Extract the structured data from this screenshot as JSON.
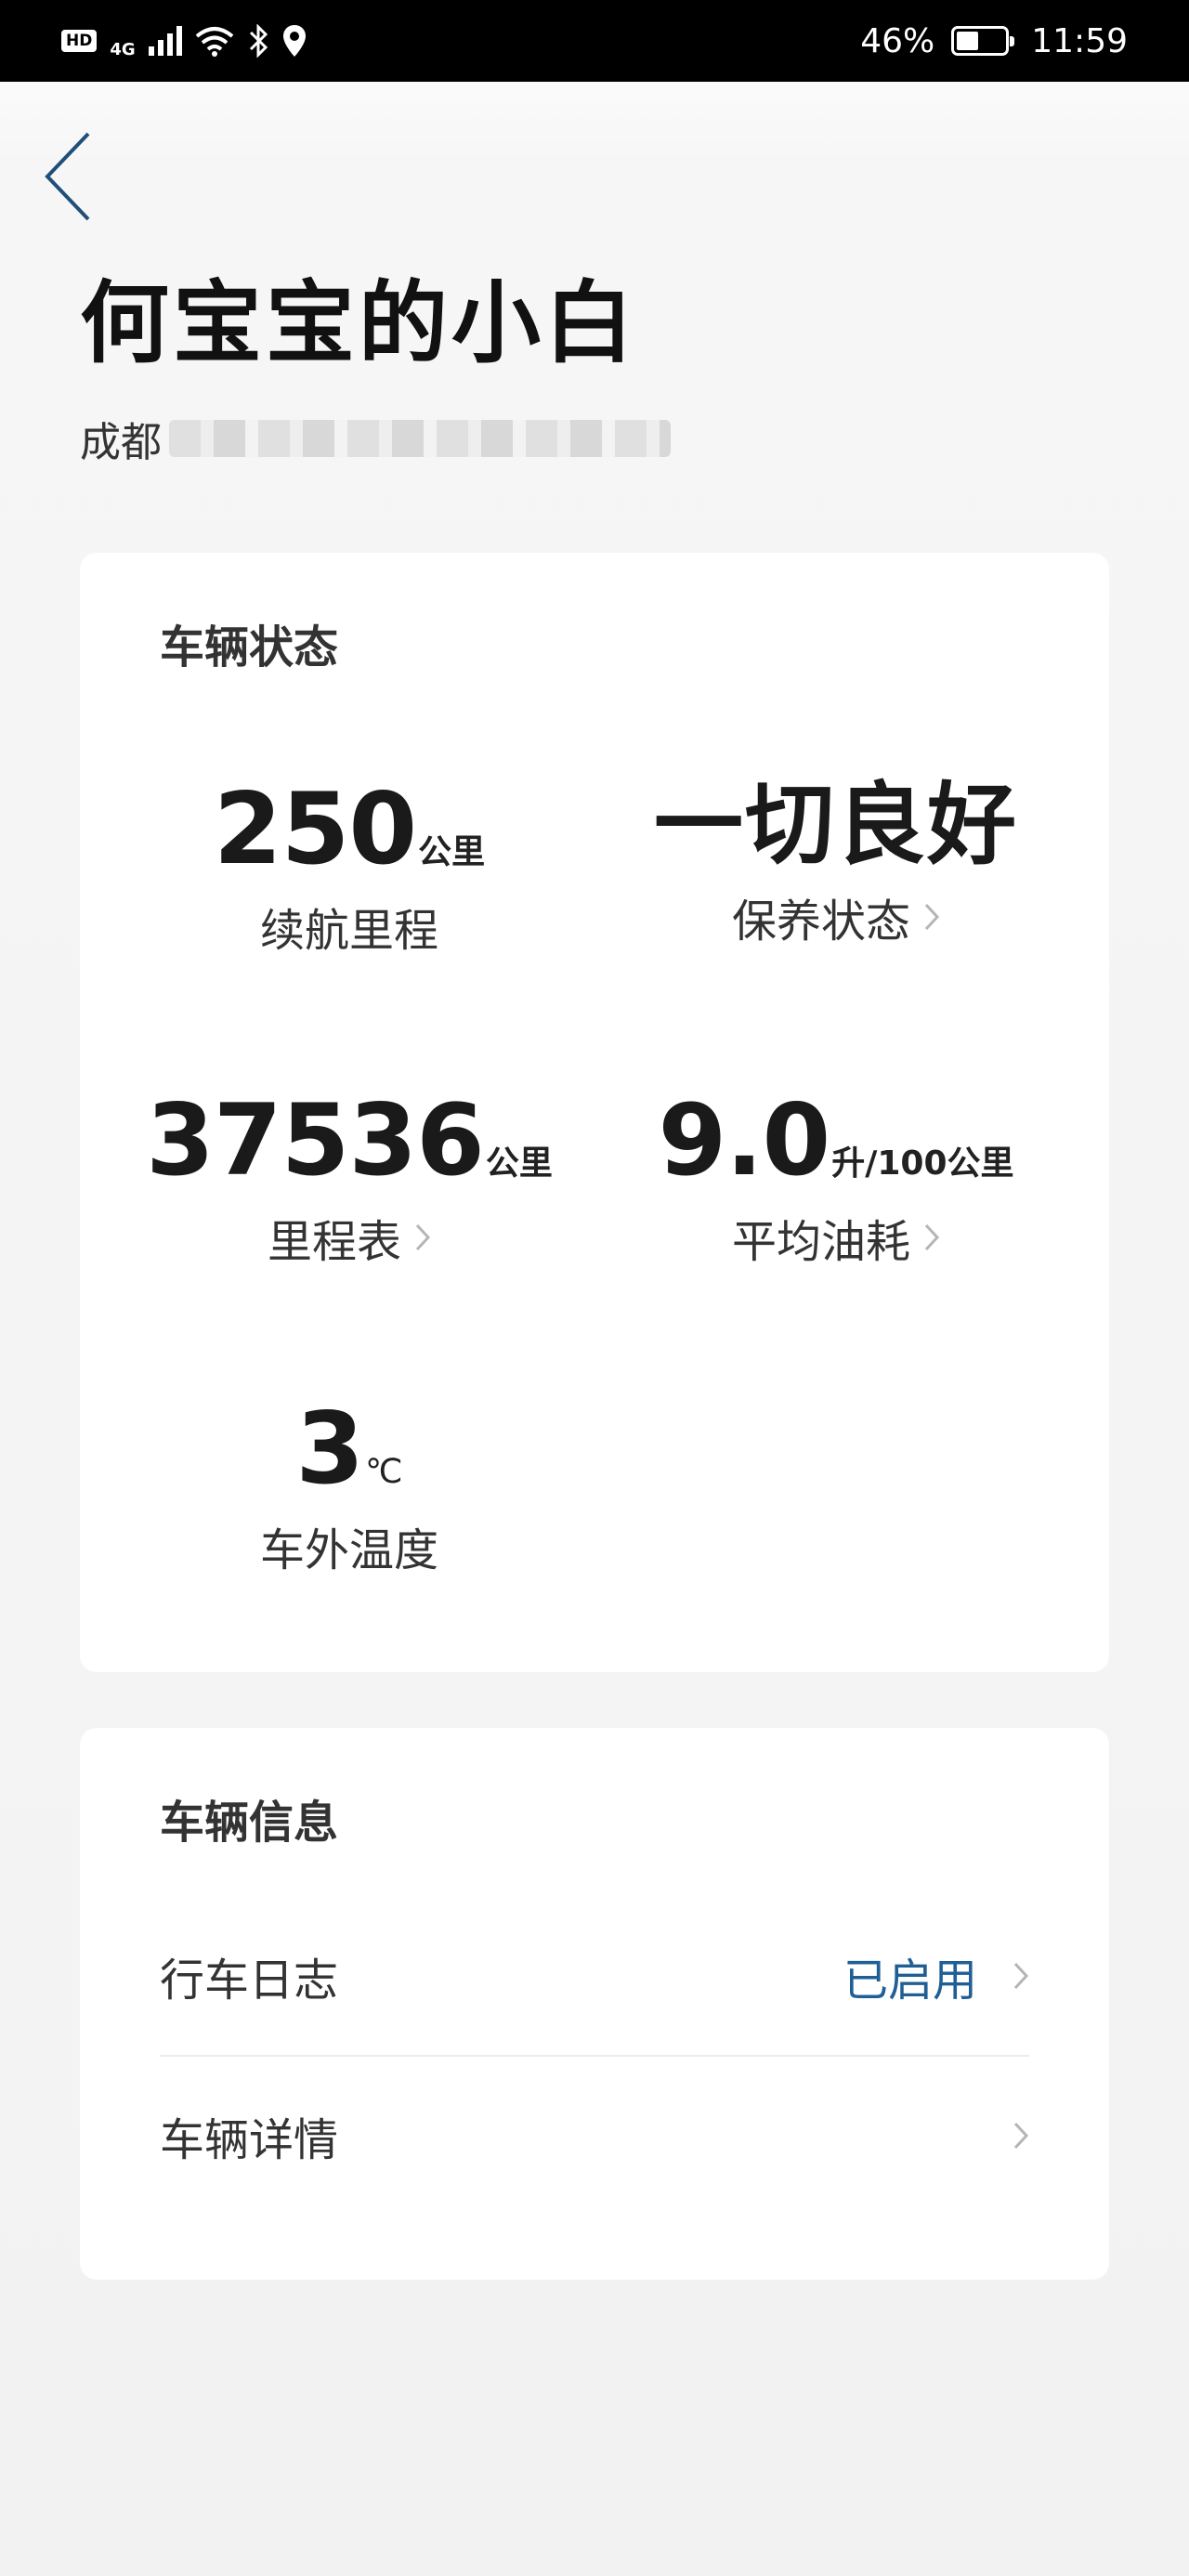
{
  "status_bar": {
    "hd": "HD",
    "network": "4G",
    "battery": "46%",
    "battery_level": 0.46,
    "time": "11:59"
  },
  "header": {
    "back_icon": "chevron-left-icon",
    "title": "何宝宝的小白",
    "location_prefix": "成都"
  },
  "vehicle_status": {
    "title": "车辆状态",
    "range": {
      "value": "250",
      "unit": "公里",
      "label": "续航里程"
    },
    "maintenance": {
      "value": "一切良好",
      "label": "保养状态"
    },
    "odometer": {
      "value": "37536",
      "unit": "公里",
      "label": "里程表"
    },
    "fuel": {
      "value": "9.0",
      "unit": "升/100公里",
      "label": "平均油耗"
    },
    "temperature": {
      "value": "3",
      "unit": "℃",
      "label": "车外温度"
    }
  },
  "vehicle_info": {
    "title": "车辆信息",
    "rows": [
      {
        "label": "行车日志",
        "status": "已启用"
      },
      {
        "label": "车辆详情",
        "status": ""
      }
    ]
  },
  "colors": {
    "accent": "#1f5f96",
    "background": "#f2f2f2",
    "card": "#ffffff"
  }
}
